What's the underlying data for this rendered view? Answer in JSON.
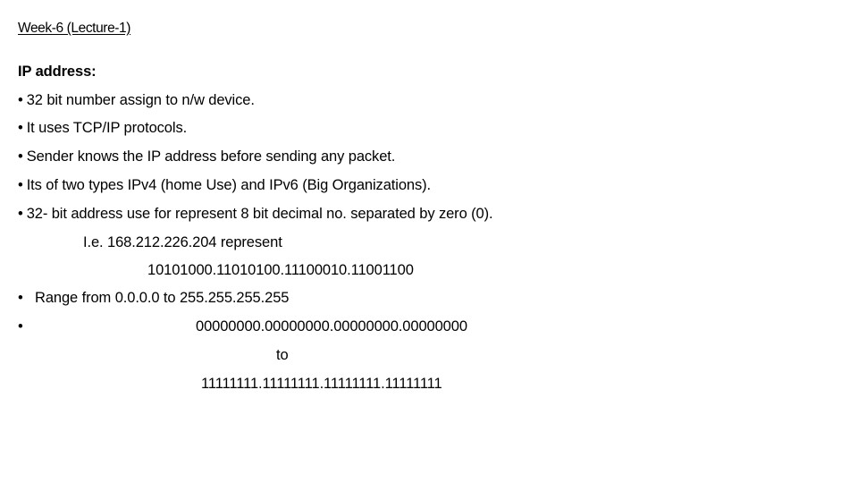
{
  "slide": {
    "title": "Week-6 (Lecture-1)",
    "heading": "IP address:",
    "bullet_symbol": "•",
    "bullets": [
      "32 bit number assign to n/w device.",
      "It uses TCP/IP protocols.",
      "Sender knows the IP address before sending any packet.",
      "Its of two types IPv4 (home Use) and IPv6 (Big Organizations).",
      "32- bit address use for represent 8 bit decimal no. separated by zero (0)."
    ],
    "example": {
      "label": "I.e. 168.212.226.204 represent",
      "binary": "10101000.11010100.11100010.11001100"
    },
    "range": {
      "text": "Range from 0.0.0.0 to 255.255.255.255",
      "binary_min": "00000000.00000000.00000000.00000000",
      "connector": "to",
      "binary_max": "11111111.11111111.11111111.11111111"
    }
  }
}
